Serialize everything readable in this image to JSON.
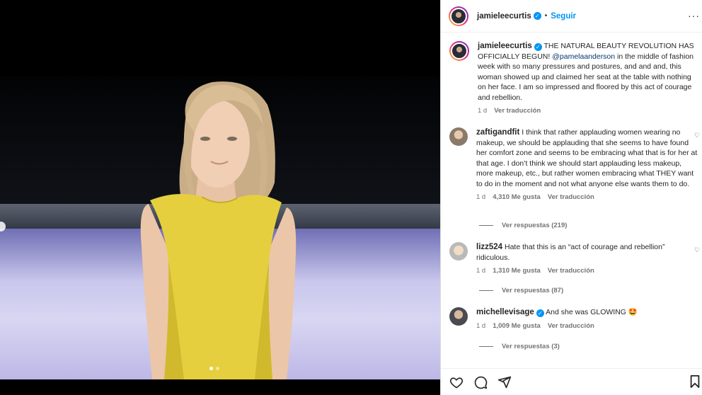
{
  "post": {
    "author": "jamieleecurtis",
    "follow_label": "Seguir",
    "separator": "•",
    "more_label": "···",
    "carousel": {
      "total": 2,
      "active_index": 1
    }
  },
  "caption": {
    "username": "jamieleecurtis",
    "text_before": " THE NATURAL BEAUTY REVOLUTION HAS OFFICIALLY BEGUN! ",
    "mention": "@pamelaanderson",
    "text_after": " in the middle of fashion week with so many pressures and postures, and and and, this woman showed up and claimed her seat at the table with nothing on her face. I am so impressed and floored by this act of courage and rebellion.",
    "time": "1 d",
    "translate": "Ver traducción"
  },
  "comments": [
    {
      "username": "zaftigandfit",
      "text": " I think that rather applauding women wearing no makeup, we should be applauding that she seems to have found her comfort zone and seems to be embracing what that is for her at that age. I don’t think we should start applauding less makeup, more makeup, etc., but rather women embracing what THEY want to do in the moment and not what anyone else wants them to do.",
      "time": "1 d",
      "likes": "4,310 Me gusta",
      "translate": "Ver traducción",
      "replies": "Ver respuestas (219)"
    },
    {
      "username": "lizz524",
      "text": " Hate that this is an “act of courage and rebellion” ridiculous.",
      "time": "1 d",
      "likes": "1,310 Me gusta",
      "translate": "Ver traducción",
      "replies": "Ver respuestas (87)"
    },
    {
      "username": "michellevisage",
      "verified": true,
      "text": " And she was GLOWING 🤩",
      "time": "1 d",
      "likes": "1,009 Me gusta",
      "translate": "Ver traducción",
      "replies": "Ver respuestas (3)"
    }
  ],
  "actions": [
    "heart-icon",
    "comment-icon",
    "share-icon",
    "bookmark-icon"
  ],
  "colors": {
    "accent": "#0095f6",
    "text": "#262626",
    "muted": "#737373",
    "dress": "#e6cf3f"
  }
}
